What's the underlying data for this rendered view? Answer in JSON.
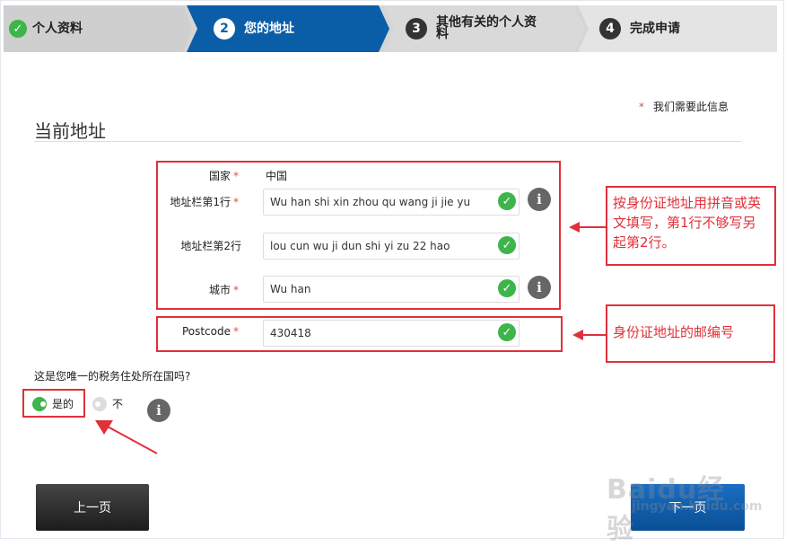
{
  "steps": [
    {
      "label": "个人资料",
      "state": "done"
    },
    {
      "number": "2",
      "label": "您的地址",
      "state": "active"
    },
    {
      "number": "3",
      "label": "其他有关的个人资料",
      "state": "todo"
    },
    {
      "number": "4",
      "label": "完成申请",
      "state": "todo"
    }
  ],
  "required_note": "我们需要此信息",
  "required_star": "*",
  "section_title": "当前地址",
  "form": {
    "country_label": "国家",
    "country_value": "中国",
    "line1_label": "地址栏第1行",
    "line1_value": "Wu han shi xin zhou qu wang ji jie yu",
    "line2_label": "地址栏第2行",
    "line2_value": "lou cun wu ji dun shi yi zu 22 hao",
    "city_label": "城市",
    "city_value": "Wu han",
    "postcode_label": "Postcode",
    "postcode_value": "430418"
  },
  "annotations": {
    "address_note": "按身份证地址用拼音或英文填写，第1行不够写另起第2行。",
    "postcode_note": "身份证地址的邮编号"
  },
  "tax_question": "这是您唯一的税务住处所在国吗?",
  "radio_yes": "是的",
  "radio_no": "不",
  "buttons": {
    "prev": "上一页",
    "next": "下一页"
  },
  "icons": {
    "check": "✓",
    "info": "i"
  },
  "watermark": {
    "line1": "Baidu经验",
    "line2": "jingyan.baidu.com"
  },
  "colors": {
    "active_step": "#0a5ea8",
    "success": "#3db54a",
    "annotation": "#e0303a"
  }
}
